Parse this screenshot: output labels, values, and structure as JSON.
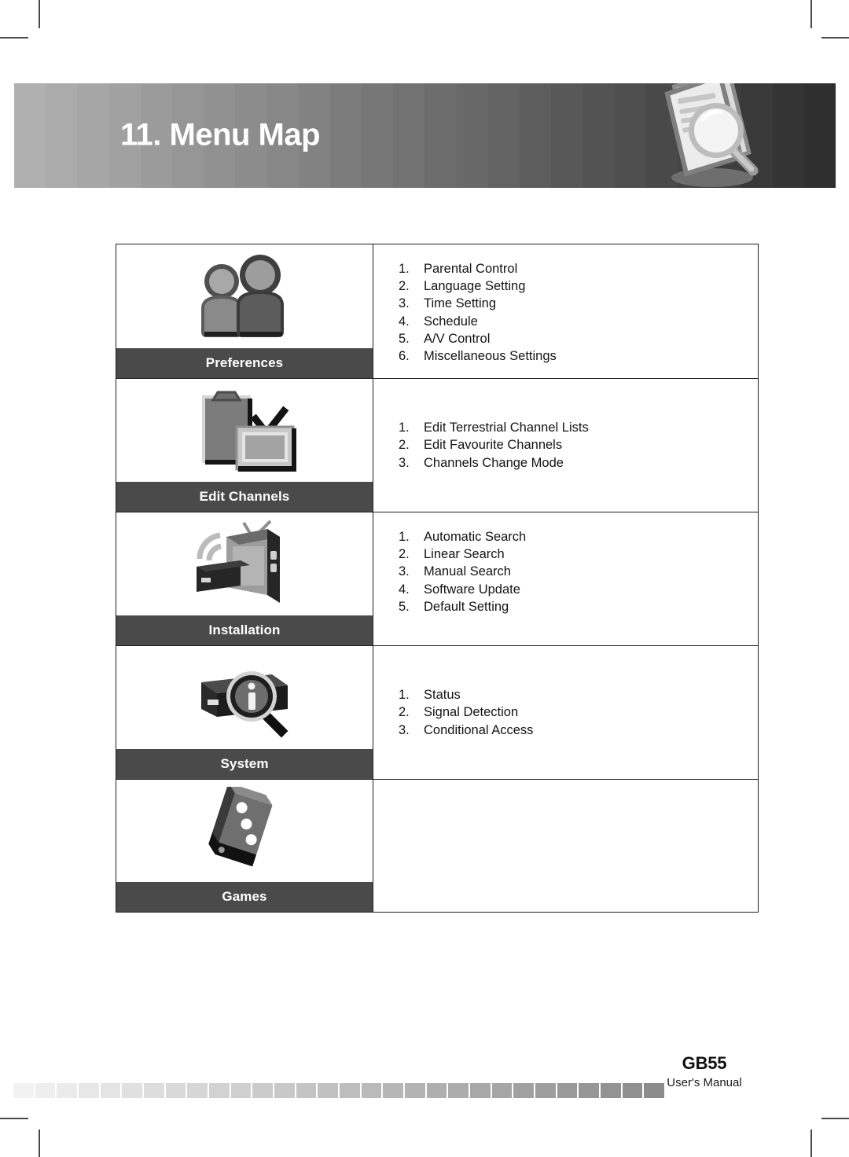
{
  "header": {
    "title": "11. Menu Map",
    "icon": "documents-magnifier-icon",
    "gradient_from": "#b0b0b0",
    "gradient_to": "#2f2f2f"
  },
  "menu_table": {
    "rows": [
      {
        "category": "Preferences",
        "icon": "two-people-icon",
        "items": [
          {
            "num": "1.",
            "label": "Parental Control"
          },
          {
            "num": "2.",
            "label": "Language Setting"
          },
          {
            "num": "3.",
            "label": "Time Setting"
          },
          {
            "num": "4.",
            "label": "Schedule"
          },
          {
            "num": "5.",
            "label": "A/V Control"
          },
          {
            "num": "6.",
            "label": "Miscellaneous Settings"
          }
        ]
      },
      {
        "category": "Edit Channels",
        "icon": "clipboard-tv-check-icon",
        "items": [
          {
            "num": "1.",
            "label": "Edit Terrestrial Channel Lists"
          },
          {
            "num": "2.",
            "label": "Edit Favourite Channels"
          },
          {
            "num": "3.",
            "label": "Channels Change Mode"
          }
        ]
      },
      {
        "category": "Installation",
        "icon": "tv-antenna-receiver-icon",
        "items": [
          {
            "num": "1.",
            "label": "Automatic Search"
          },
          {
            "num": "2.",
            "label": "Linear Search"
          },
          {
            "num": "3.",
            "label": "Manual Search"
          },
          {
            "num": "4.",
            "label": "Software Update"
          },
          {
            "num": "5.",
            "label": "Default Setting"
          }
        ]
      },
      {
        "category": "System",
        "icon": "receiver-info-magnifier-icon",
        "items": [
          {
            "num": "1.",
            "label": "Status"
          },
          {
            "num": "2.",
            "label": "Signal Detection"
          },
          {
            "num": "3.",
            "label": "Conditional Access"
          }
        ]
      },
      {
        "category": "Games",
        "icon": "dice-icon",
        "items": []
      }
    ],
    "label_background": "#4a4a4a",
    "label_color": "#ffffff",
    "border_color": "#1e1e1e"
  },
  "footer": {
    "code": "GB55",
    "subtitle": "User's Manual",
    "bar_from": "#f2f2f2",
    "bar_to": "#8c8c8c"
  }
}
